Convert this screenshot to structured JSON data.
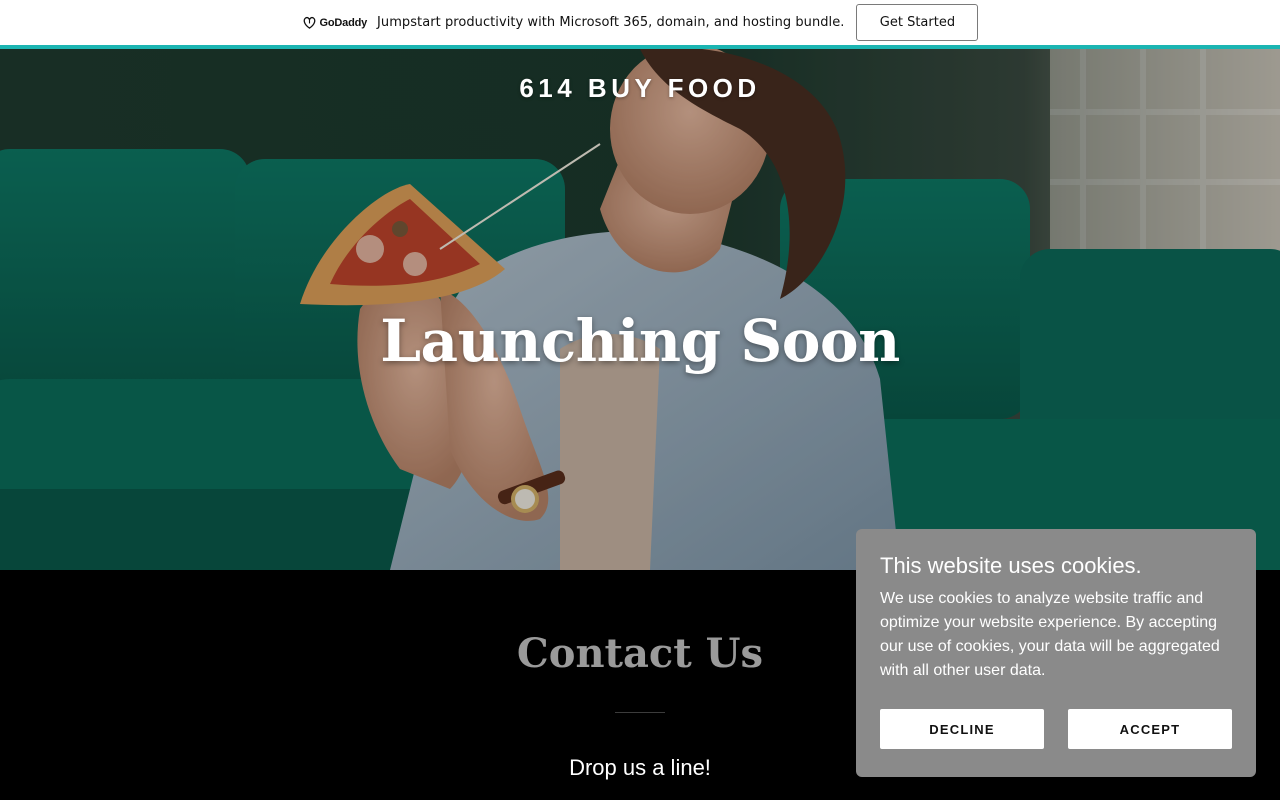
{
  "promo": {
    "logo_text": "GoDaddy",
    "message": "Jumpstart productivity with Microsoft 365, domain, and hosting bundle.",
    "cta_label": "Get Started",
    "accent_color": "#1bb5b2"
  },
  "hero": {
    "brand": "614 BUY FOOD",
    "heading": "Launching Soon"
  },
  "contact": {
    "title": "Contact Us",
    "subtitle": "Drop us a line!"
  },
  "cookie_banner": {
    "title": "This website uses cookies.",
    "body": "We use cookies to analyze website traffic and optimize your website experience. By accepting our use of cookies, your data will be aggregated with all other user data.",
    "decline_label": "DECLINE",
    "accept_label": "ACCEPT",
    "background_color": "#8a8a8a"
  }
}
